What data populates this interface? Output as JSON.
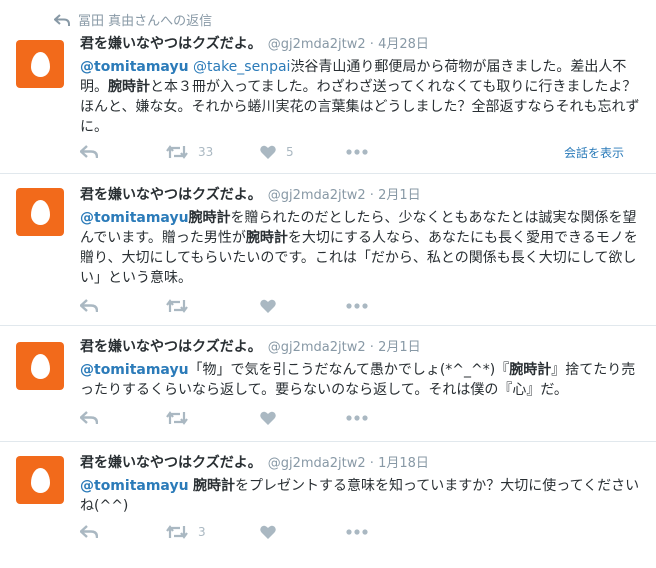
{
  "reply_context": "冨田 真由さんへの返信",
  "show_conversation": "会話を表示",
  "tweets": [
    {
      "name": "君を嫌いなやつはクズだよ。",
      "handle": "@gj2mda2jtw2",
      "date": "4月28日",
      "mention1": "@tomitamayu",
      "mention2": "@take_senpai",
      "t1": "渋谷青山通り郵便局から荷物が届きました。差出人不明。",
      "b1": "腕時計",
      "t2": "と本３冊が入ってました。わざわざ送ってくれなくても取りに行きましたよ？ほんと、嫌な女。それから蜷川実花の言葉集はどうしました？全部返すならそれも忘れずに。",
      "retweets": "33",
      "likes": "5"
    },
    {
      "name": "君を嫌いなやつはクズだよ。",
      "handle": "@gj2mda2jtw2",
      "date": "2月1日",
      "mention1": "@tomitamayu",
      "b1": "腕時計",
      "t1": "を贈られたのだとしたら、少なくともあなたとは誠実な関係を望んでいます。贈った男性が",
      "b2": "腕時計",
      "t2": "を大切にする人なら、あなたにも長く愛用できるモノを贈り、大切にしてもらいたいのです。これは「だから、私との関係も長く大切にして欲しい」という意味。"
    },
    {
      "name": "君を嫌いなやつはクズだよ。",
      "handle": "@gj2mda2jtw2",
      "date": "2月1日",
      "mention1": "@tomitamayu",
      "t1": "「物」で気を引こうだなんて愚かでしょ(*^_^*)『",
      "b1": "腕時計",
      "t2": "』捨てたり売ったりするくらいなら返して。要らないのなら返して。それは僕の『心』だ。"
    },
    {
      "name": "君を嫌いなやつはクズだよ。",
      "handle": "@gj2mda2jtw2",
      "date": "1月18日",
      "mention1": "@tomitamayu",
      "b1": "腕時計",
      "t1": "をプレゼントする意味を知っていますか？大切に使ってくださいね(^^)",
      "retweets": "3"
    }
  ],
  "sep": "·",
  "icons": [
    "reply-arrow-icon",
    "reply-icon",
    "retweet-icon",
    "heart-icon",
    "more-icon",
    "egg-avatar-icon"
  ],
  "colors": {
    "avatar": "#f26a1b",
    "link": "#2b7bb9",
    "muted": "#8899a6",
    "icon": "#aab8c2"
  }
}
